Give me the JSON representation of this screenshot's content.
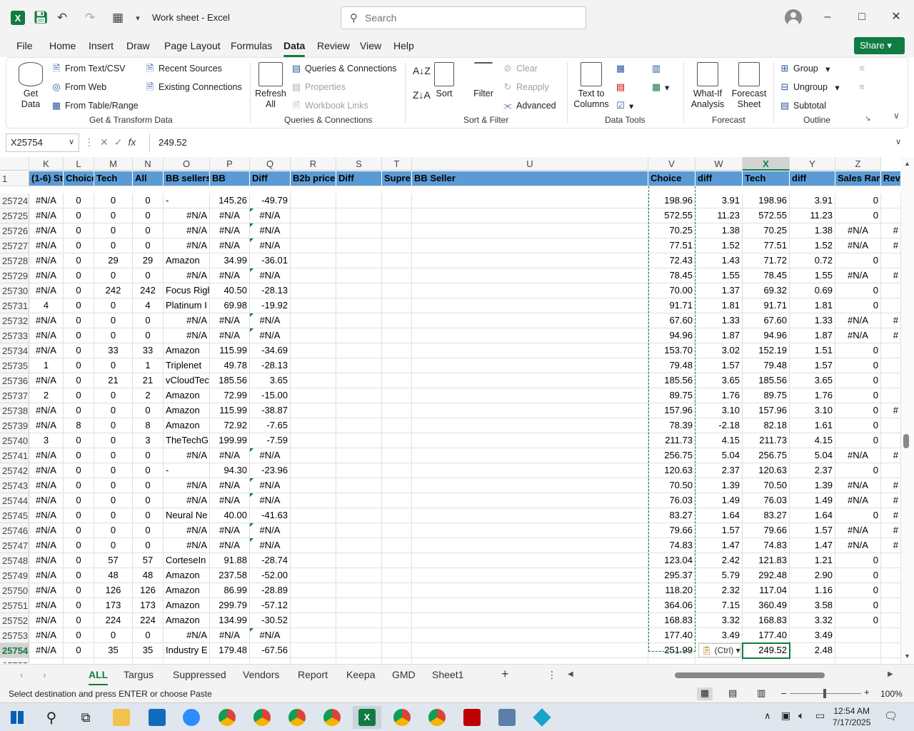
{
  "window": {
    "title": "Work sheet  -  Excel",
    "search_placeholder": "Search"
  },
  "menu": [
    "File",
    "Home",
    "Insert",
    "Draw",
    "Page Layout",
    "Formulas",
    "Data",
    "Review",
    "View",
    "Help"
  ],
  "share_label": "Share",
  "ribbon": {
    "get_data": "Get Data",
    "from_text": "From Text/CSV",
    "from_web": "From Web",
    "from_table": "From Table/Range",
    "recent_sources": "Recent Sources",
    "existing_connections": "Existing Connections",
    "group_get_transform": "Get & Transform Data",
    "refresh_all": "Refresh All",
    "queries_connections": "Queries & Connections",
    "properties": "Properties",
    "workbook_links": "Workbook Links",
    "group_queries": "Queries & Connections",
    "sort": "Sort",
    "filter": "Filter",
    "clear": "Clear",
    "reapply": "Reapply",
    "advanced": "Advanced",
    "group_sort_filter": "Sort & Filter",
    "text_to_columns": "Text to Columns",
    "group_data_tools": "Data Tools",
    "what_if": "What-If Analysis",
    "forecast_sheet": "Forecast Sheet",
    "group_forecast": "Forecast",
    "group": "Group",
    "ungroup": "Ungroup",
    "subtotal": "Subtotal",
    "group_outline": "Outline"
  },
  "formula_bar": {
    "name_box": "X25754",
    "formula": "249.52"
  },
  "columns": [
    "K",
    "L",
    "M",
    "N",
    "O",
    "P",
    "Q",
    "R",
    "S",
    "T",
    "U",
    "V",
    "W",
    "X",
    "Y",
    "Z"
  ],
  "header_row": {
    "num": "1",
    "cells": [
      "(1-6) St",
      "Choice",
      "Tech",
      "All",
      "BB sellers",
      "BB",
      "Diff",
      "B2b price",
      "Diff",
      "Supre",
      "BB Seller",
      "Choice",
      "diff",
      "Tech",
      "diff",
      "Sales Rar",
      "Rev"
    ]
  },
  "rows": [
    [
      "25724",
      "#N/A",
      "0",
      "0",
      "0",
      "-",
      "145.26",
      "-49.79",
      "",
      "",
      "",
      "",
      "198.96",
      "3.91",
      "198.96",
      "3.91",
      "0",
      ""
    ],
    [
      "25725",
      "#N/A",
      "0",
      "0",
      "0",
      "#N/A",
      "#N/A",
      "#N/A",
      "",
      "",
      "",
      "",
      "572.55",
      "11.23",
      "572.55",
      "11.23",
      "0",
      ""
    ],
    [
      "25726",
      "#N/A",
      "0",
      "0",
      "0",
      "#N/A",
      "#N/A",
      "#N/A",
      "",
      "",
      "",
      "",
      "70.25",
      "1.38",
      "70.25",
      "1.38",
      "#N/A",
      "#"
    ],
    [
      "25727",
      "#N/A",
      "0",
      "0",
      "0",
      "#N/A",
      "#N/A",
      "#N/A",
      "",
      "",
      "",
      "",
      "77.51",
      "1.52",
      "77.51",
      "1.52",
      "#N/A",
      "#"
    ],
    [
      "25728",
      "#N/A",
      "0",
      "29",
      "29",
      "Amazon",
      "34.99",
      "-36.01",
      "",
      "",
      "",
      "",
      "72.43",
      "1.43",
      "71.72",
      "0.72",
      "0",
      ""
    ],
    [
      "25729",
      "#N/A",
      "0",
      "0",
      "0",
      "#N/A",
      "#N/A",
      "#N/A",
      "",
      "",
      "",
      "",
      "78.45",
      "1.55",
      "78.45",
      "1.55",
      "#N/A",
      "#"
    ],
    [
      "25730",
      "#N/A",
      "0",
      "242",
      "242",
      "Focus Righ",
      "40.50",
      "-28.13",
      "",
      "",
      "",
      "",
      "70.00",
      "1.37",
      "69.32",
      "0.69",
      "0",
      ""
    ],
    [
      "25731",
      "4",
      "0",
      "0",
      "4",
      "Platinum I",
      "69.98",
      "-19.92",
      "",
      "",
      "",
      "",
      "91.71",
      "1.81",
      "91.71",
      "1.81",
      "0",
      ""
    ],
    [
      "25732",
      "#N/A",
      "0",
      "0",
      "0",
      "#N/A",
      "#N/A",
      "#N/A",
      "",
      "",
      "",
      "",
      "67.60",
      "1.33",
      "67.60",
      "1.33",
      "#N/A",
      "#"
    ],
    [
      "25733",
      "#N/A",
      "0",
      "0",
      "0",
      "#N/A",
      "#N/A",
      "#N/A",
      "",
      "",
      "",
      "",
      "94.96",
      "1.87",
      "94.96",
      "1.87",
      "#N/A",
      "#"
    ],
    [
      "25734",
      "#N/A",
      "0",
      "33",
      "33",
      "Amazon",
      "115.99",
      "-34.69",
      "",
      "",
      "",
      "",
      "153.70",
      "3.02",
      "152.19",
      "1.51",
      "0",
      ""
    ],
    [
      "25735",
      "1",
      "0",
      "0",
      "1",
      "Triplenet",
      "49.78",
      "-28.13",
      "",
      "",
      "",
      "",
      "79.48",
      "1.57",
      "79.48",
      "1.57",
      "0",
      ""
    ],
    [
      "25736",
      "#N/A",
      "0",
      "21",
      "21",
      "vCloudTec",
      "185.56",
      "3.65",
      "",
      "",
      "",
      "",
      "185.56",
      "3.65",
      "185.56",
      "3.65",
      "0",
      ""
    ],
    [
      "25737",
      "2",
      "0",
      "0",
      "2",
      "Amazon",
      "72.99",
      "-15.00",
      "",
      "",
      "",
      "",
      "89.75",
      "1.76",
      "89.75",
      "1.76",
      "0",
      ""
    ],
    [
      "25738",
      "#N/A",
      "0",
      "0",
      "0",
      "Amazon",
      "115.99",
      "-38.87",
      "",
      "",
      "",
      "",
      "157.96",
      "3.10",
      "157.96",
      "3.10",
      "0",
      "#"
    ],
    [
      "25739",
      "#N/A",
      "8",
      "0",
      "8",
      "Amazon",
      "72.92",
      "-7.65",
      "",
      "",
      "",
      "",
      "78.39",
      "-2.18",
      "82.18",
      "1.61",
      "0",
      ""
    ],
    [
      "25740",
      "3",
      "0",
      "0",
      "3",
      "TheTechG",
      "199.99",
      "-7.59",
      "",
      "",
      "",
      "",
      "211.73",
      "4.15",
      "211.73",
      "4.15",
      "0",
      ""
    ],
    [
      "25741",
      "#N/A",
      "0",
      "0",
      "0",
      "#N/A",
      "#N/A",
      "#N/A",
      "",
      "",
      "",
      "",
      "256.75",
      "5.04",
      "256.75",
      "5.04",
      "#N/A",
      "#"
    ],
    [
      "25742",
      "#N/A",
      "0",
      "0",
      "0",
      "-",
      "94.30",
      "-23.96",
      "",
      "",
      "",
      "",
      "120.63",
      "2.37",
      "120.63",
      "2.37",
      "0",
      ""
    ],
    [
      "25743",
      "#N/A",
      "0",
      "0",
      "0",
      "#N/A",
      "#N/A",
      "#N/A",
      "",
      "",
      "",
      "",
      "70.50",
      "1.39",
      "70.50",
      "1.39",
      "#N/A",
      "#"
    ],
    [
      "25744",
      "#N/A",
      "0",
      "0",
      "0",
      "#N/A",
      "#N/A",
      "#N/A",
      "",
      "",
      "",
      "",
      "76.03",
      "1.49",
      "76.03",
      "1.49",
      "#N/A",
      "#"
    ],
    [
      "25745",
      "#N/A",
      "0",
      "0",
      "0",
      "Neural Ne",
      "40.00",
      "-41.63",
      "",
      "",
      "",
      "",
      "83.27",
      "1.64",
      "83.27",
      "1.64",
      "0",
      "#"
    ],
    [
      "25746",
      "#N/A",
      "0",
      "0",
      "0",
      "#N/A",
      "#N/A",
      "#N/A",
      "",
      "",
      "",
      "",
      "79.66",
      "1.57",
      "79.66",
      "1.57",
      "#N/A",
      "#"
    ],
    [
      "25747",
      "#N/A",
      "0",
      "0",
      "0",
      "#N/A",
      "#N/A",
      "#N/A",
      "",
      "",
      "",
      "",
      "74.83",
      "1.47",
      "74.83",
      "1.47",
      "#N/A",
      "#"
    ],
    [
      "25748",
      "#N/A",
      "0",
      "57",
      "57",
      "CorteseIn",
      "91.88",
      "-28.74",
      "",
      "",
      "",
      "",
      "123.04",
      "2.42",
      "121.83",
      "1.21",
      "0",
      ""
    ],
    [
      "25749",
      "#N/A",
      "0",
      "48",
      "48",
      "Amazon",
      "237.58",
      "-52.00",
      "",
      "",
      "",
      "",
      "295.37",
      "5.79",
      "292.48",
      "2.90",
      "0",
      ""
    ],
    [
      "25750",
      "#N/A",
      "0",
      "126",
      "126",
      "Amazon",
      "86.99",
      "-28.89",
      "",
      "",
      "",
      "",
      "118.20",
      "2.32",
      "117.04",
      "1.16",
      "0",
      ""
    ],
    [
      "25751",
      "#N/A",
      "0",
      "173",
      "173",
      "Amazon",
      "299.79",
      "-57.12",
      "",
      "",
      "",
      "",
      "364.06",
      "7.15",
      "360.49",
      "3.58",
      "0",
      ""
    ],
    [
      "25752",
      "#N/A",
      "0",
      "224",
      "224",
      "Amazon",
      "134.99",
      "-30.52",
      "",
      "",
      "",
      "",
      "168.83",
      "3.32",
      "168.83",
      "3.32",
      "0",
      ""
    ],
    [
      "25753",
      "#N/A",
      "0",
      "0",
      "0",
      "#N/A",
      "#N/A",
      "#N/A",
      "",
      "",
      "",
      "",
      "177.40",
      "3.49",
      "177.40",
      "3.49",
      "",
      ""
    ],
    [
      "25754",
      "#N/A",
      "0",
      "35",
      "35",
      "Industry E",
      "179.48",
      "-67.56",
      "",
      "",
      "",
      "",
      "251.99",
      "",
      "249.52",
      "2.48",
      "",
      ""
    ],
    [
      "25755",
      "",
      "",
      "",
      "",
      "",
      "",
      "",
      "",
      "",
      "",
      "",
      "",
      "",
      "",
      "",
      "",
      ""
    ]
  ],
  "paste_options": "(Ctrl)",
  "sheet_tabs": [
    "ALL",
    "Targus",
    "Suppressed",
    "Vendors",
    "Report",
    "Keepa",
    "GMD",
    "Sheet1"
  ],
  "active_tab": "ALL",
  "status": {
    "message": "Select destination and press ENTER or choose Paste",
    "zoom": "100%"
  },
  "clock": {
    "time": "12:54 AM",
    "date": "7/17/2025"
  }
}
